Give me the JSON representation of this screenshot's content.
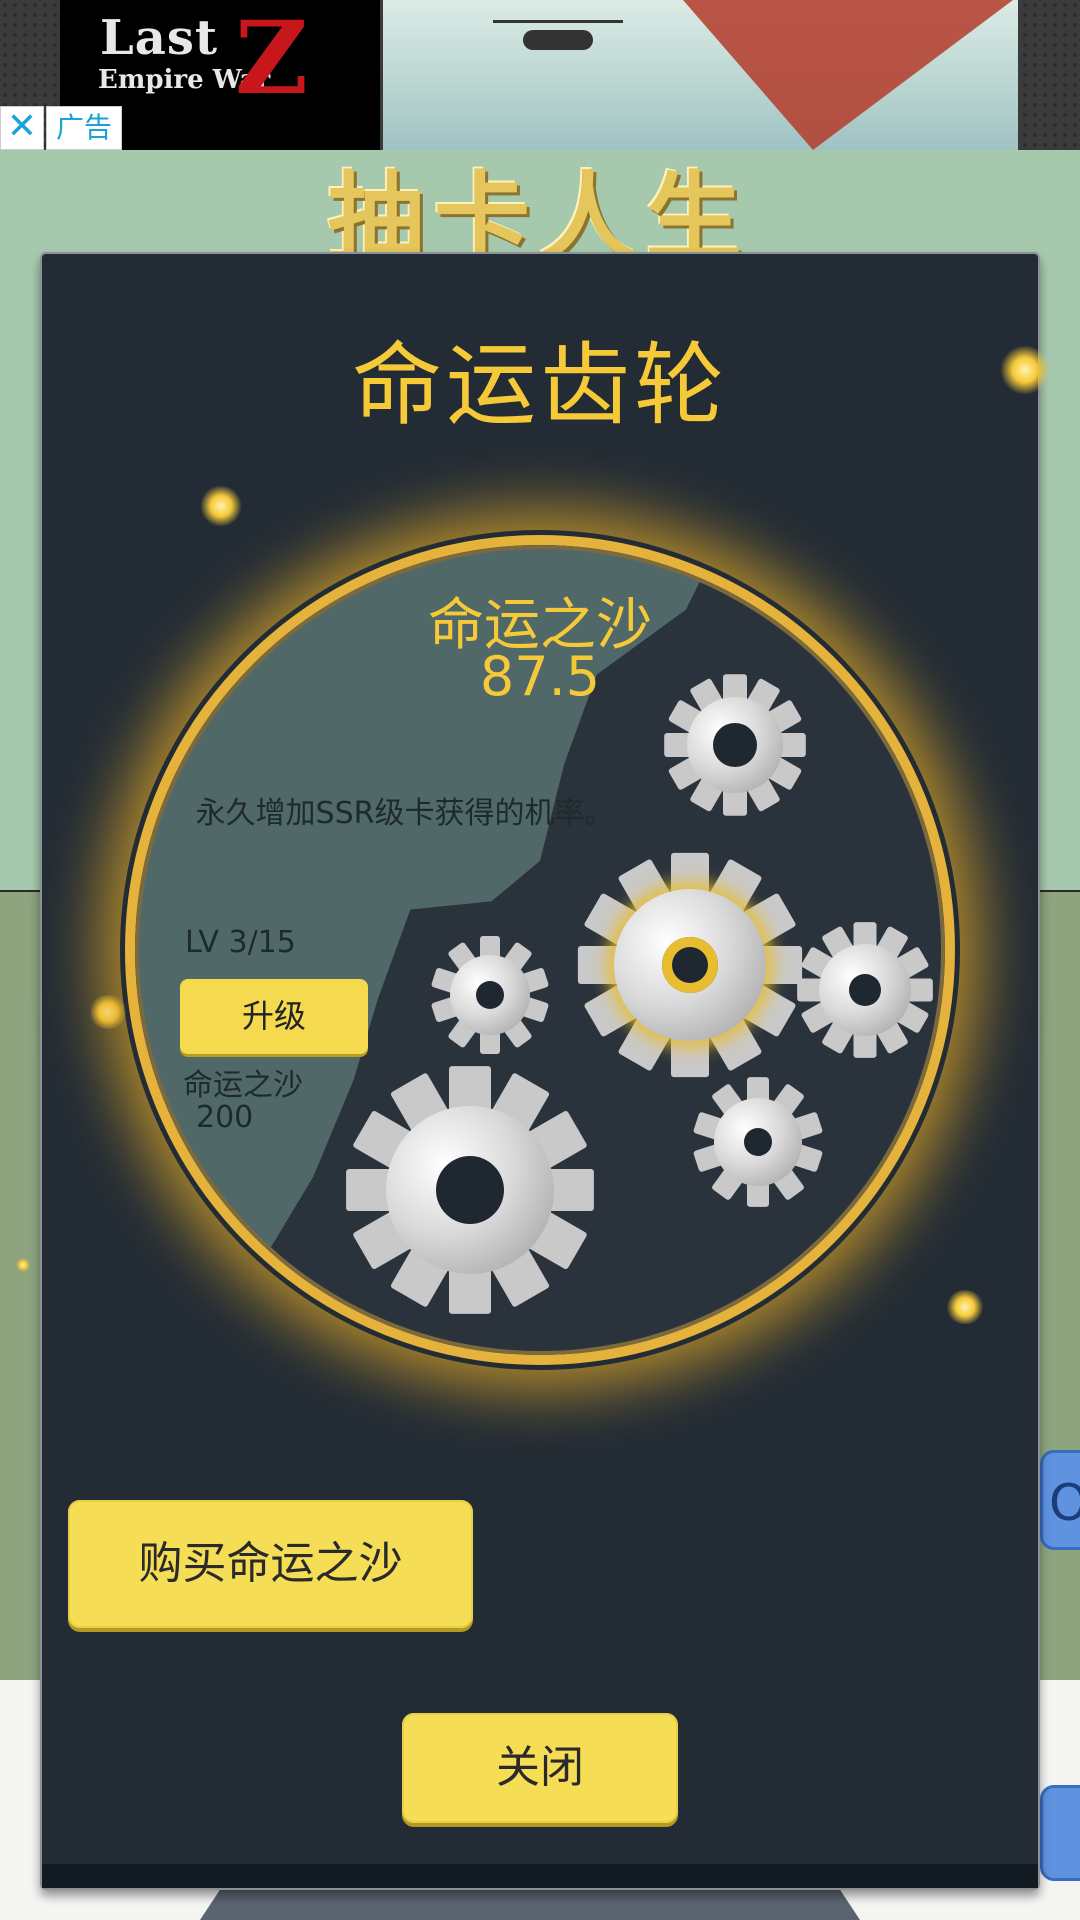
{
  "ad": {
    "logo_line1": "Last",
    "logo_line2": "Empire War",
    "logo_z": "Z",
    "close_symbol": "✕",
    "label": "广告"
  },
  "background": {
    "title": "抽卡人生",
    "side_button_glyph": "O"
  },
  "modal": {
    "title": "命运齿轮",
    "sand_label": "命运之沙",
    "sand_value": "87.5",
    "description": "永久增加SSR级卡获得的机率。",
    "level": "LV 3/15",
    "upgrade_label": "升级",
    "cost_label": "命运之沙",
    "cost_value": "200",
    "buy_label": "购买命运之沙",
    "close_label": "关闭"
  },
  "colors": {
    "accent_gold": "#f5c938",
    "button_yellow": "#f5dd55",
    "modal_bg": "#232c35",
    "wheel_left": "#506968"
  },
  "icons": [
    "close-icon",
    "gear-icon"
  ]
}
